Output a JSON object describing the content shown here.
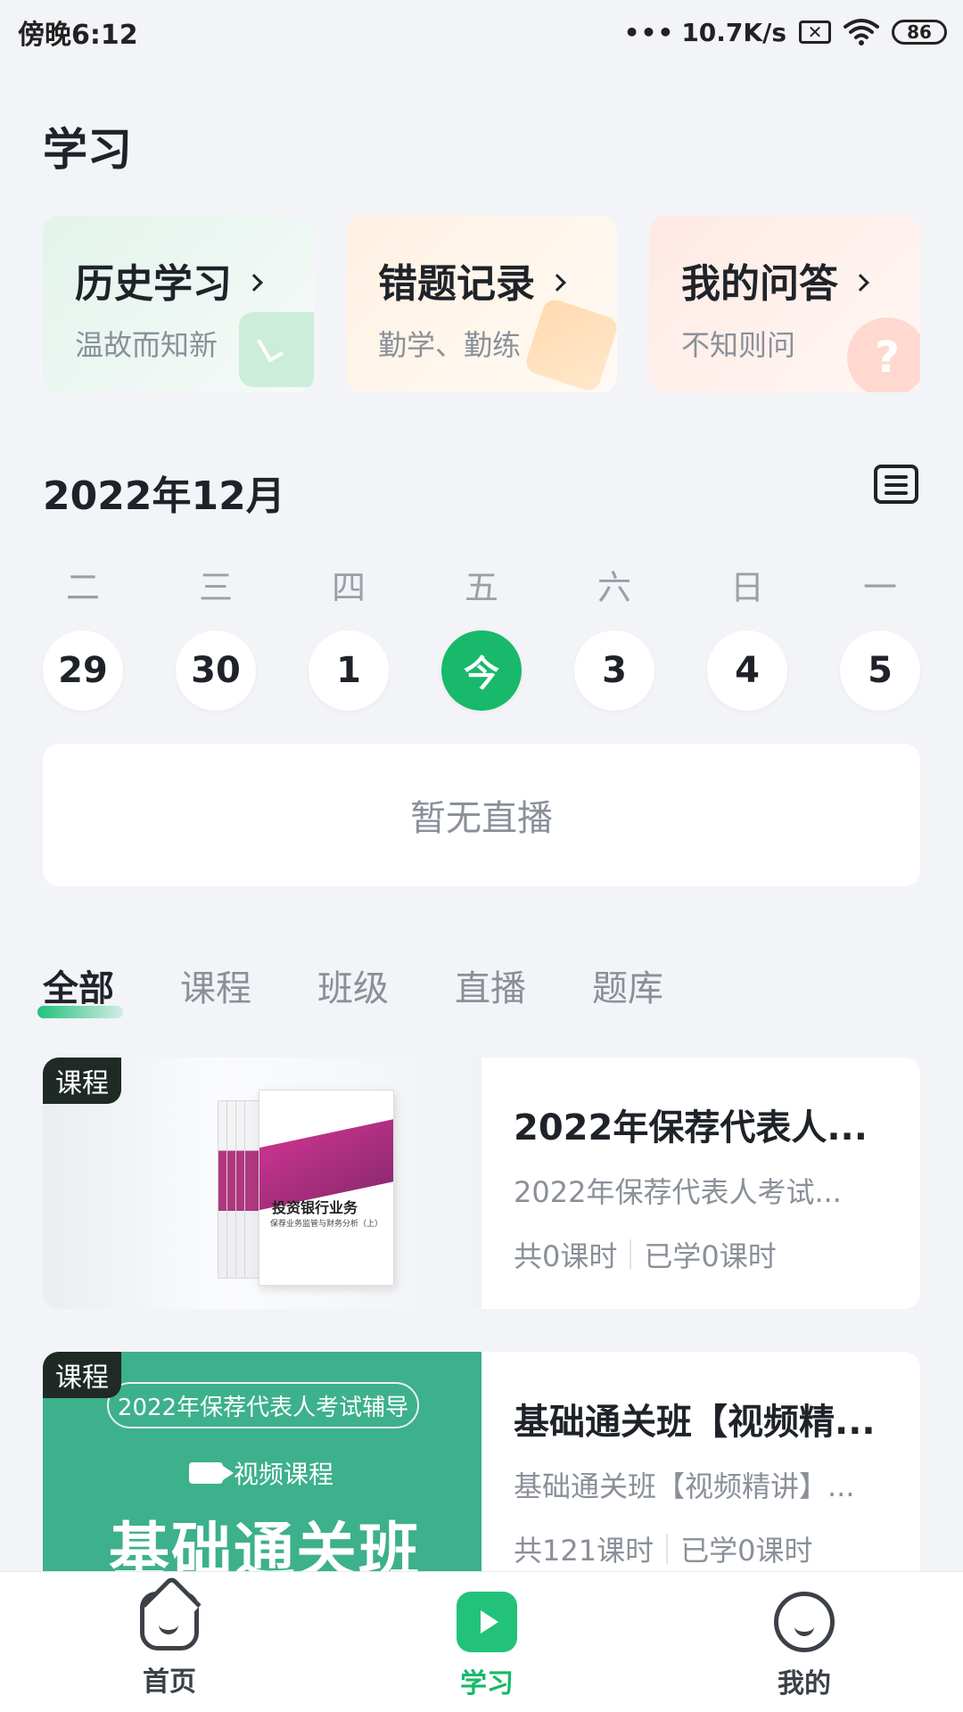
{
  "status_bar": {
    "time": "傍晚6:12",
    "dots": "•••",
    "network_speed": "10.7K/s",
    "sim_icon": "x-box-icon",
    "wifi_icon": "wifi-icon",
    "battery": "86"
  },
  "page_title": "学习",
  "quick_cards": [
    {
      "title": "历史学习",
      "subtitle": "温故而知新",
      "icon": "clock-icon"
    },
    {
      "title": "错题记录",
      "subtitle": "勤学、勤练",
      "icon": "notebook-icon"
    },
    {
      "title": "我的问答",
      "subtitle": "不知则问",
      "icon": "question-icon",
      "icon_text": "?"
    }
  ],
  "calendar": {
    "month": "2022年12月",
    "weekdays": [
      "二",
      "三",
      "四",
      "五",
      "六",
      "日",
      "一"
    ],
    "days": [
      "29",
      "30",
      "1",
      "今",
      "3",
      "4",
      "5"
    ],
    "selected_index": 3,
    "accent_color": "#18B96A"
  },
  "live": {
    "empty_text": "暂无直播"
  },
  "filter_tabs": [
    "全部",
    "课程",
    "班级",
    "直播",
    "题库"
  ],
  "courses": [
    {
      "tag": "课程",
      "title": "2022年保荐代表人...",
      "desc": "2022年保荐代表人考试...",
      "total": "共0课时",
      "learned": "已学0课时",
      "cover": {
        "book_title": "投资银行业务",
        "book_subtitle": "保荐业务监管与财务分析（上）"
      }
    },
    {
      "tag": "课程",
      "title": "基础通关班【视频精...",
      "desc": "基础通关班【视频精讲】...",
      "total": "共121课时",
      "learned": "已学0课时",
      "cover": {
        "pill": "2022年保荐代表人考试辅导",
        "video_label": "视频课程",
        "big_title": "基础通关班"
      }
    }
  ],
  "bottom_nav": [
    {
      "label": "首页",
      "icon": "home-icon"
    },
    {
      "label": "学习",
      "icon": "play-icon"
    },
    {
      "label": "我的",
      "icon": "smile-icon"
    }
  ]
}
